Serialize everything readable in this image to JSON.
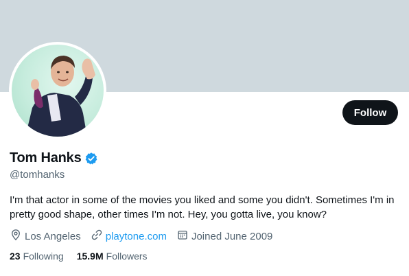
{
  "profile": {
    "name": "Tom Hanks",
    "handle": "@tomhanks",
    "bio": "I'm that actor in some of the movies you liked and some you didn't. Sometimes I'm in pretty good shape, other times I'm not. Hey, you gotta live, you know?",
    "location": "Los Angeles",
    "website": "playtone.com",
    "joined": "Joined June 2009",
    "verified": true
  },
  "actions": {
    "follow_label": "Follow"
  },
  "stats": {
    "following_count": "23",
    "following_label": "Following",
    "followers_count": "15.9M",
    "followers_label": "Followers"
  },
  "colors": {
    "banner": "#cfd9de",
    "verified_badge": "#1d9bf0",
    "link": "#1d9bf0",
    "follow_button": "#0f1419"
  },
  "icons": {
    "verified": "verified-badge-icon",
    "location": "location-pin-icon",
    "website": "link-icon",
    "joined": "calendar-icon"
  }
}
